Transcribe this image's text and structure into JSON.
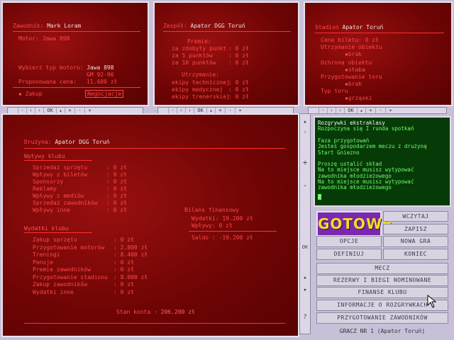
{
  "player_panel": {
    "name_label": "Zawodnik:",
    "name": "Mark Loram",
    "engine_label": "Motor:",
    "engine": "Jawa 898",
    "choose_label": "Wybierz typ motoru:",
    "choose_val1": "Jawa 898",
    "choose_val2": "GM 92-96",
    "price_label": "Proponowana cena:",
    "price": "11.600 zł",
    "buy_label": "Zakup",
    "negotiate_label": "Negocjacje"
  },
  "team_panel": {
    "title_label": "Zespół:",
    "title": "Apator DGG Toruń",
    "prizes_label": "Premie:",
    "prizes": [
      {
        "label": "za zdobyty punkt",
        "value": ": 0 zł"
      },
      {
        "label": "za 5 punktów",
        "value": ": 0 zł"
      },
      {
        "label": "za 10 punktów",
        "value": ": 0 zł"
      }
    ],
    "upkeep_label": "Utrzymanie:",
    "upkeep": [
      {
        "label": "ekipy technicznej",
        "value": ": 0 zł"
      },
      {
        "label": "ekipy medycznej",
        "value": ": 0 zł"
      },
      {
        "label": "ekipy trenerskiej",
        "value": ": 0 zł"
      }
    ]
  },
  "stadium_panel": {
    "title_label": "Stadion",
    "title": "Apator Toruń",
    "ticket_label": "Cena biletu:",
    "ticket": "0 zł",
    "upkeep_label": "Utrzymanie obiektu",
    "upkeep": "brak",
    "protection_label": "Ochrona obiektu",
    "protection": "słaba",
    "track_prep_label": "Przygotowanie toru",
    "track_prep": "brak",
    "track_type_label": "Typ toru",
    "track_type": "grząski"
  },
  "toolbar": {
    "ok": "OK",
    "plus": "+",
    "minus": "-"
  },
  "finance_panel": {
    "team_label": "Drużyna:",
    "team": "Apator DGG Toruń",
    "income_title": "Wpływy klubu",
    "income": [
      {
        "label": "Sprzedaż sprzętu",
        "value": ": 0 zł"
      },
      {
        "label": "Wpływy z biletów",
        "value": ": 0 zł"
      },
      {
        "label": "Sponsorzy",
        "value": ": 0 zł"
      },
      {
        "label": "Reklamy",
        "value": ": 0 zł"
      },
      {
        "label": "Wpływy z mediów",
        "value": ": 0 zł"
      },
      {
        "label": "Sprzedaż zawodników",
        "value": ": 0 zł"
      },
      {
        "label": "Wpływy inne",
        "value": ": 0 zł"
      }
    ],
    "expense_title": "Wydatki klubu",
    "expenses": [
      {
        "label": "Zakup sprzętu",
        "value": ": 0 zł"
      },
      {
        "label": "Przygotowanie motorów",
        "value": ": 2.800 zł"
      },
      {
        "label": "Treningi",
        "value": ": 8.400 zł"
      },
      {
        "label": "Pensje",
        "value": ": 0 zł"
      },
      {
        "label": "Premie zawodników",
        "value": ": 0 zł"
      },
      {
        "label": "Przygotowanie stadionu",
        "value": ": 8.000 zł"
      },
      {
        "label": "Zakup zawodników",
        "value": ": 0 zł"
      },
      {
        "label": "Wydatki inne",
        "value": ": 0 zł"
      }
    ],
    "balance_title": "Bilans finansowy",
    "balance_expenses_label": "Wydatki:",
    "balance_expenses": "19.200 zł",
    "balance_income_label": "Wpływy:",
    "balance_income": "0 zł",
    "balance_saldo_label": "Saldo :",
    "balance_saldo": "-19.200 zł",
    "account_label": "Stan konta :",
    "account": "206.200 zł"
  },
  "log": {
    "lines": [
      "Rozgrywki ekstraklasy",
      "Rozpoczyna się I runda spotkań",
      "",
      "Faza przygotowań",
      "Jesteś gospodarzem meczu z drużyną",
      "Start Gniezno",
      "",
      "Proszę ustalić skład",
      "Na to miejsce musisz wytypować",
      "zawodnika młodzieżowego",
      "Na to miejsce musisz wytypować",
      "zawodnika młodzieżowego"
    ]
  },
  "menu": {
    "gotowe": "GOTOWE",
    "wczytaj": "WCZYTAJ",
    "zapisz": "ZAPISZ",
    "opcje": "OPCJE",
    "nowa_gra": "NOWA GRA",
    "definiuj": "DEFINIUJ",
    "koniec": "KONIEC",
    "mecz": "MECZ",
    "rezerwy": "REZERWY I BIEGI NOMINOWANE",
    "finanse": "FINANSE KLUBU",
    "informacje": "INFORMACJE O ROZGRYWKACH",
    "przygotowanie": "PRZYGOTOWANIE ZAWODNIKÓW"
  },
  "status": {
    "text": "GRACZ NR 1   (Apator Toruń)"
  },
  "colors": {
    "panel": "#7a0606",
    "label_red": "#ff4848",
    "log_green": "#6cff6c",
    "gotowe_yellow": "#f0e020"
  }
}
